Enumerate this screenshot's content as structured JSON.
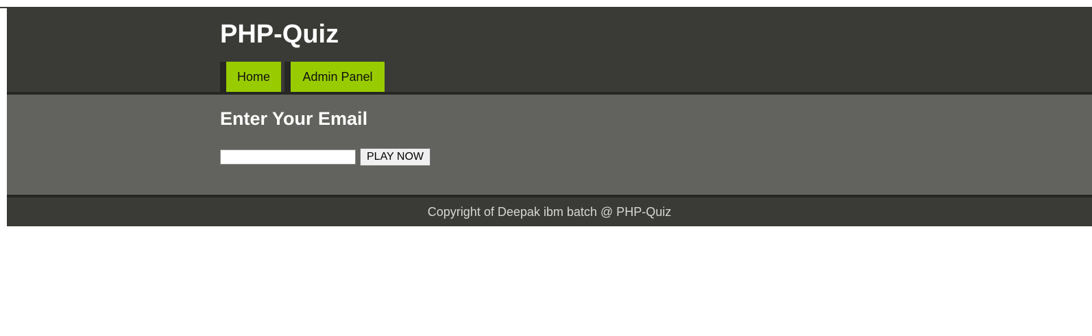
{
  "header": {
    "site_title": "PHP-Quiz",
    "nav": [
      {
        "label": "Home"
      },
      {
        "label": "Admin Panel"
      }
    ]
  },
  "main": {
    "heading": "Enter Your Email",
    "email_value": "",
    "play_label": "PLAY NOW"
  },
  "footer": {
    "copyright": "Copyright of Deepak ibm batch @ PHP-Quiz"
  },
  "colors": {
    "header_bg": "#3a3a36",
    "main_bg": "#62625e",
    "nav_accent": "#99cc00"
  }
}
